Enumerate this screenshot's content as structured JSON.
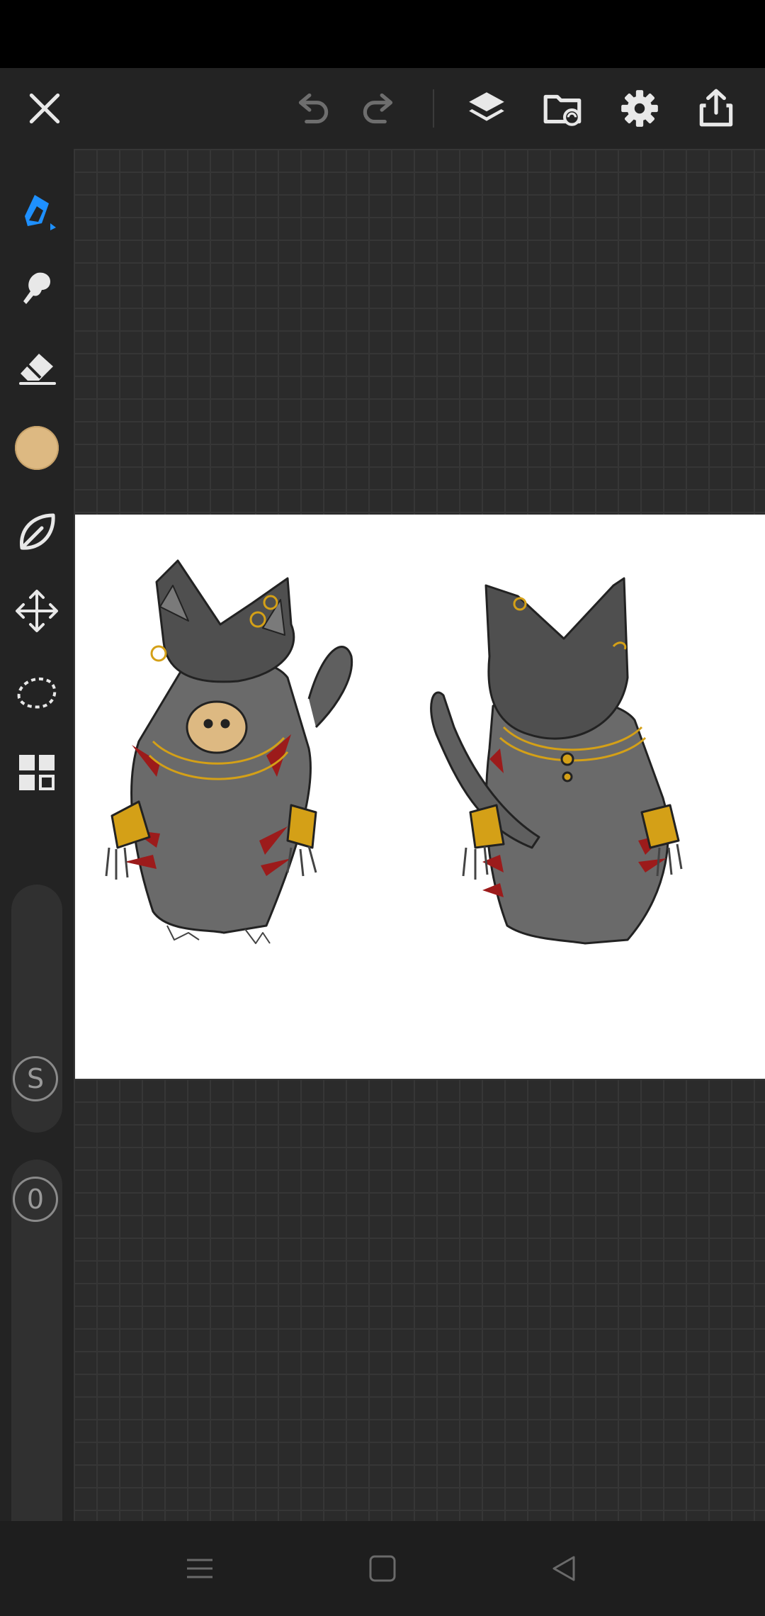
{
  "app": {
    "name": "Drawing canvas"
  },
  "topbar": {
    "close": "close-icon",
    "undo": "undo-icon",
    "redo": "redo-icon",
    "layers": "layers-icon",
    "gallery": "gallery-import-icon",
    "settings": "gear-icon",
    "share": "share-icon"
  },
  "tools": [
    {
      "name": "pen",
      "icon": "pen-icon",
      "active": true,
      "accent": "#1e90ff"
    },
    {
      "name": "smudge",
      "icon": "smudge-icon"
    },
    {
      "name": "eraser",
      "icon": "eraser-icon"
    },
    {
      "name": "color",
      "icon": "color-swatch",
      "color": "#ddb982"
    },
    {
      "name": "fill",
      "icon": "leaf-icon"
    },
    {
      "name": "transform",
      "icon": "move-icon"
    },
    {
      "name": "lasso",
      "icon": "lasso-icon"
    },
    {
      "name": "gallery",
      "icon": "grid-icon"
    }
  ],
  "brush": {
    "size_label": "S",
    "opacity_label": "0"
  },
  "nav": {
    "menu": "menu-icon",
    "home": "home-icon",
    "back": "back-icon"
  },
  "colors": {
    "accent": "#1e90ff",
    "bar": "#232323",
    "canvas_bg": "#2b2b2b",
    "cat_gray": "#656565",
    "cat_red": "#9c1b1b",
    "cat_gold": "#d4a017",
    "muzzle": "#ddb982"
  }
}
